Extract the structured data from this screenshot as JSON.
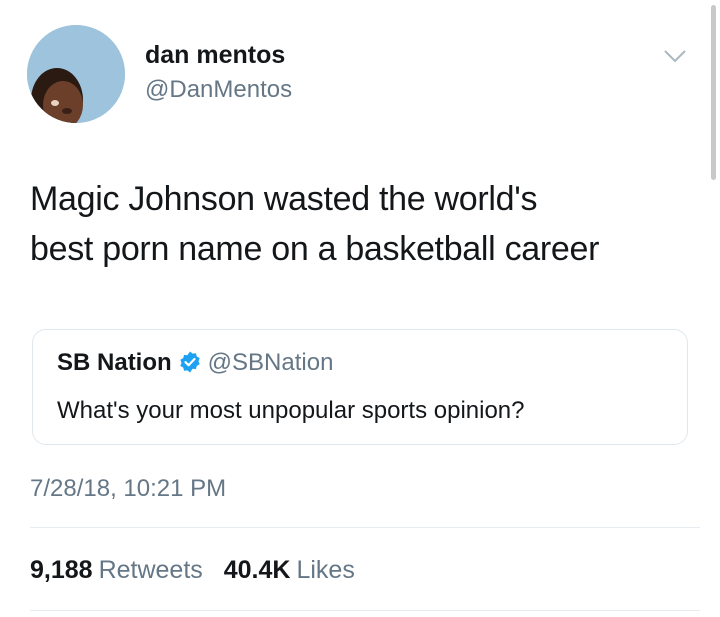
{
  "tweet": {
    "author": {
      "display_name": "dan mentos",
      "handle": "@DanMentos",
      "avatar_icon": "profile-photo"
    },
    "menu_icon": "chevron-down-icon",
    "text_lines": [
      "Magic Johnson wasted the world's",
      "best porn name on a basketball career"
    ],
    "quoted_tweet": {
      "display_name": "SB Nation",
      "verified_icon": "verified-badge-icon",
      "handle": "@SBNation",
      "text": "What's your most unpopular sports opinion?"
    },
    "timestamp": "7/28/18, 10:21 PM",
    "stats": {
      "retweets_count": "9,188",
      "retweets_label": "Retweets",
      "likes_count": "40.4K",
      "likes_label": "Likes"
    }
  },
  "colors": {
    "text_primary": "#14171a",
    "text_secondary": "#657786",
    "verified_blue": "#1da1f2",
    "border": "#e1e8ed",
    "avatar_bg": "#9ec3dc"
  }
}
